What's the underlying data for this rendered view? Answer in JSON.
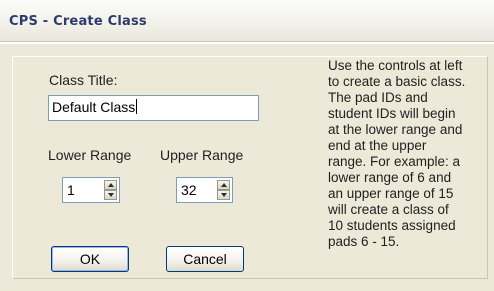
{
  "window": {
    "title": "CPS - Create Class"
  },
  "form": {
    "class_title_label": "Class Title:",
    "class_title_value": "Default Class",
    "lower_range_label": "Lower Range",
    "upper_range_label": "Upper Range",
    "lower_range_value": "1",
    "upper_range_value": "32"
  },
  "buttons": {
    "ok_label": "OK",
    "cancel_label": "Cancel"
  },
  "help_text": [
    "Use the controls at left",
    "to create a basic class.",
    "The pad IDs and",
    "student IDs will begin",
    "at the lower range and",
    "end at the upper",
    "range. For example: a",
    "lower range of 6 and",
    "an upper range of 15",
    "will create a class of",
    "10 students assigned",
    "pads 6 - 15."
  ],
  "icons": {
    "spin_up": "arrow-up-icon",
    "spin_down": "arrow-down-icon"
  }
}
